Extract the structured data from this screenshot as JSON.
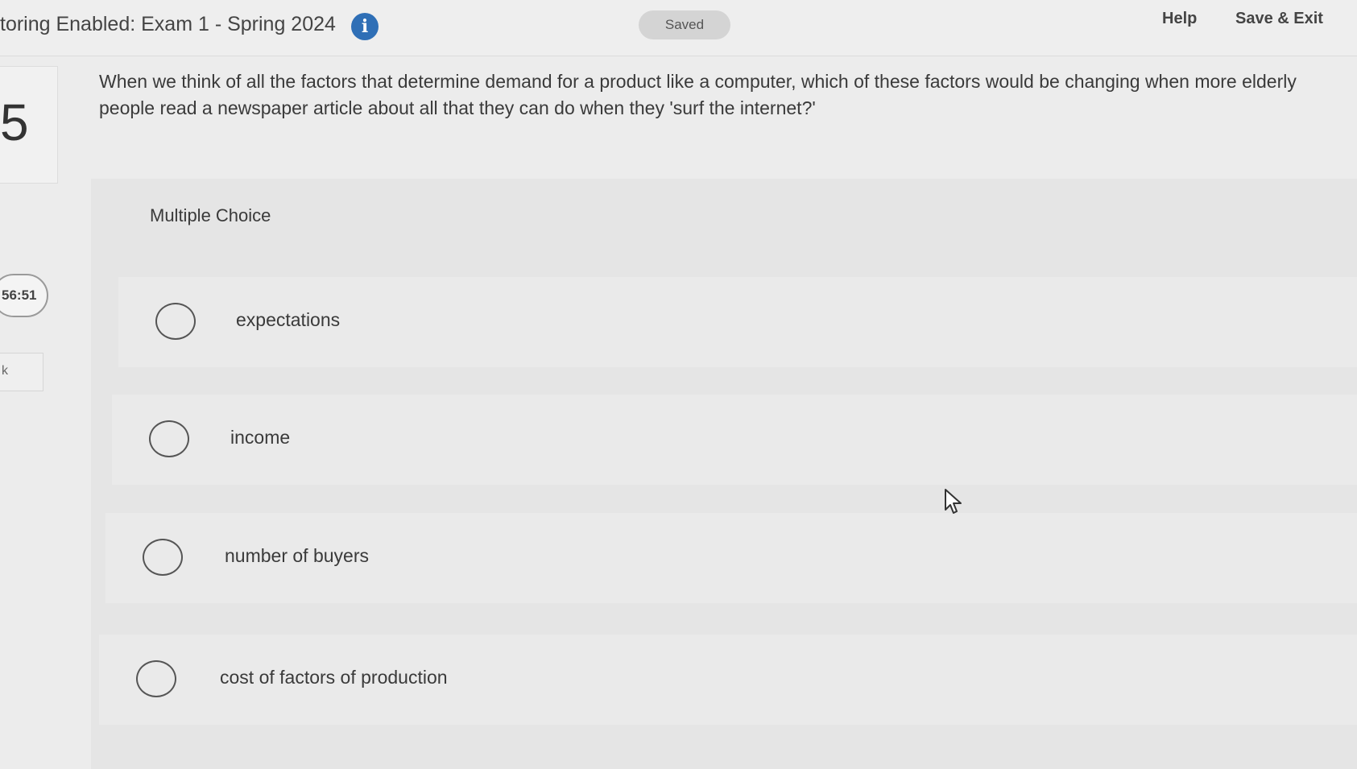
{
  "header": {
    "title": "toring Enabled: Exam 1 - Spring 2024",
    "info_icon": "info-icon",
    "saved_status": "Saved",
    "help_label": "Help",
    "save_exit_label": "Save & Exit"
  },
  "sidebar": {
    "question_number": "5",
    "timer": "56:51",
    "side_box_text": "k"
  },
  "question": {
    "text": "When we think of all the factors that determine demand for a product like a computer, which of these factors would be changing when more elderly people read a newspaper article about all that they can do when they 'surf the internet?'",
    "type_label": "Multiple Choice"
  },
  "choices": [
    {
      "label": "expectations",
      "selected": false
    },
    {
      "label": "income",
      "selected": false
    },
    {
      "label": "number of buyers",
      "selected": false
    },
    {
      "label": "cost of factors of production",
      "selected": false
    }
  ],
  "colors": {
    "info_icon": "#2f6fb6",
    "background": "#ececec",
    "answer_area": "#e5e5e5"
  }
}
